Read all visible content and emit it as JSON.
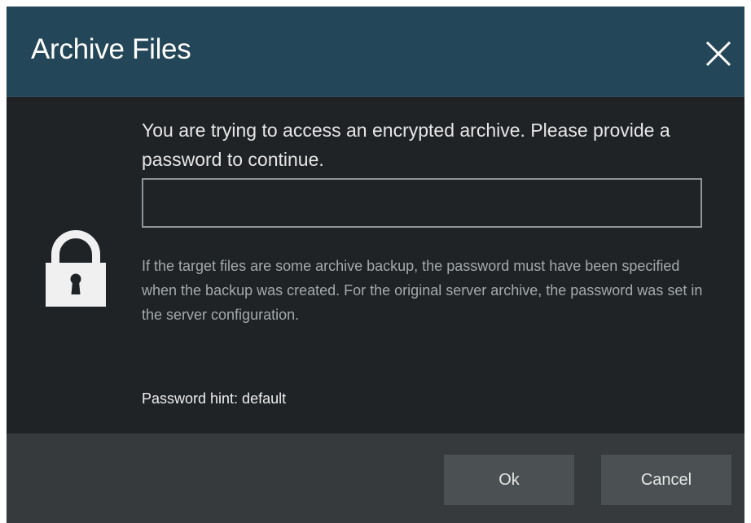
{
  "dialog": {
    "title": "Archive Files",
    "close_icon": "close-icon",
    "lock_icon": "lock-icon",
    "prompt": "You are trying to access an encrypted archive. Please provide a password to continue.",
    "password": {
      "value": "",
      "placeholder": ""
    },
    "note": "If the target files are some archive backup, the password must have been specified when the backup was created. For the original server archive, the password was set in the server configuration.",
    "hint": "Password hint: default",
    "buttons": {
      "ok": "Ok",
      "cancel": "Cancel"
    }
  },
  "colors": {
    "titlebar": "#234659",
    "body": "#1f2326",
    "footer": "#363a3c",
    "button": "#4b5052"
  }
}
